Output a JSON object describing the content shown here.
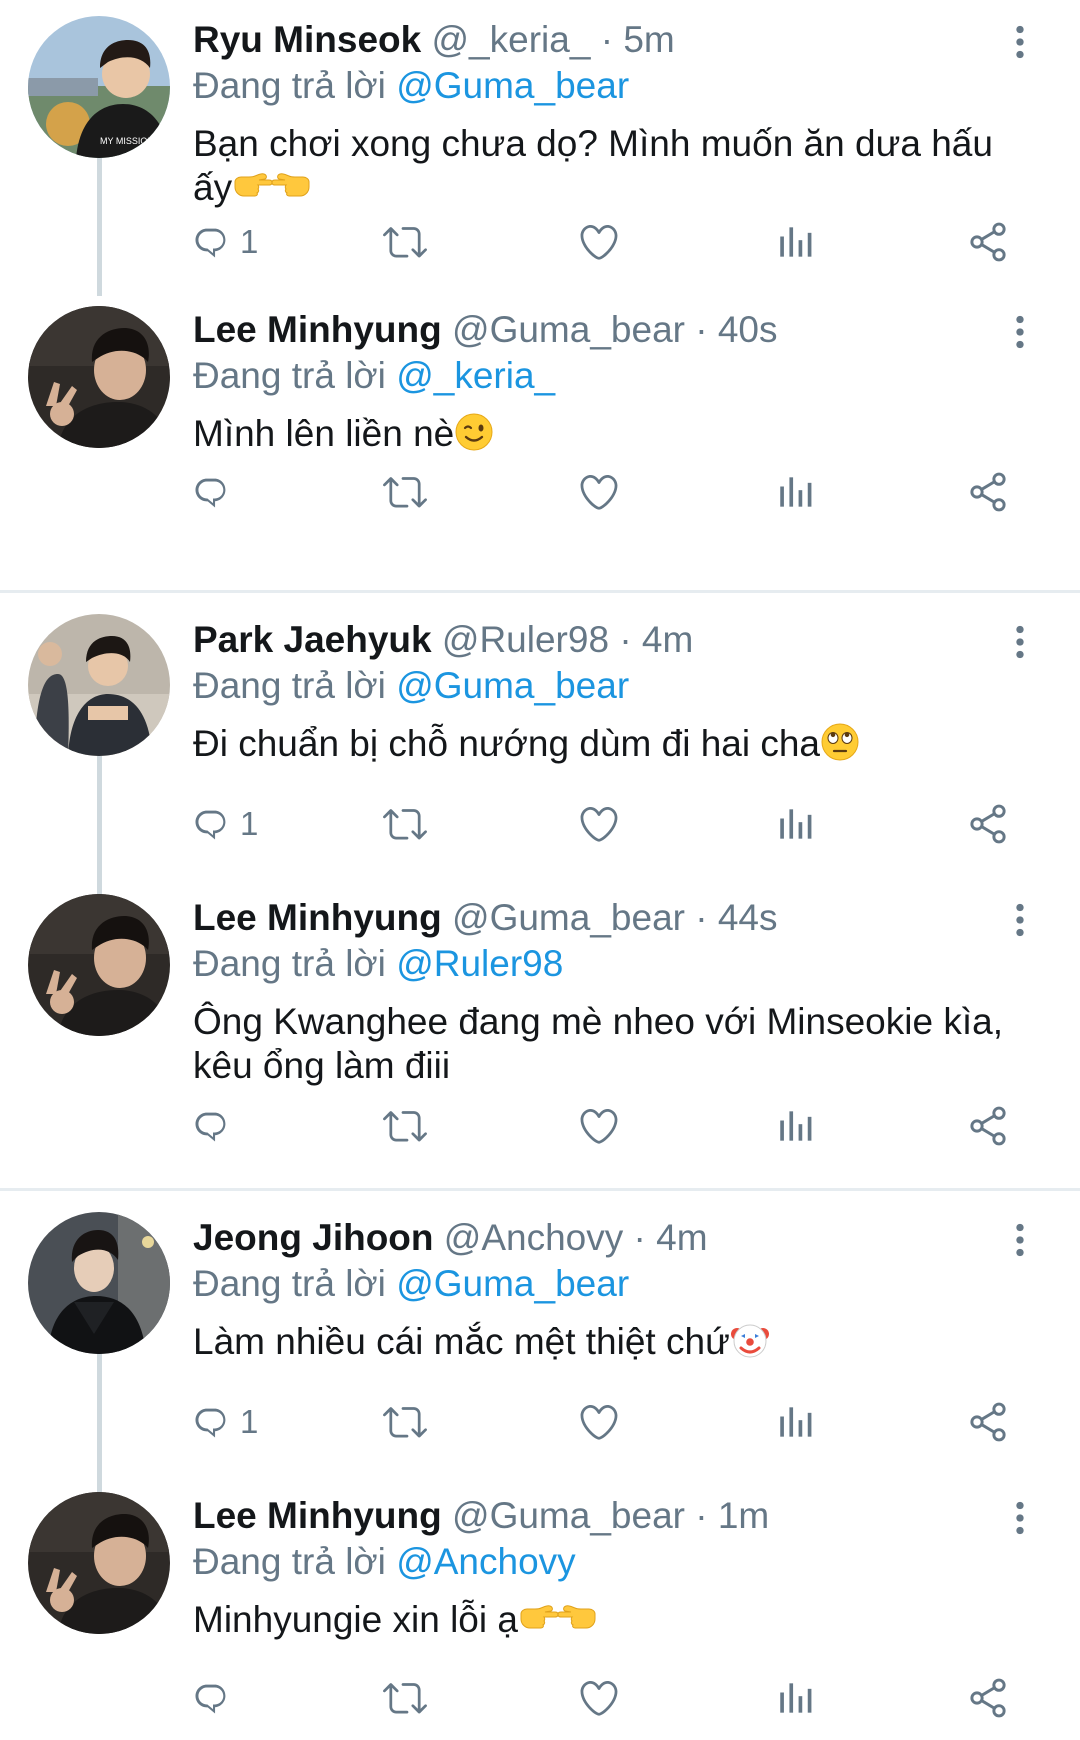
{
  "reply_prefix": "Đang trả lời",
  "threads": [
    {
      "tweets": [
        {
          "name": "Ryu Minseok",
          "handle": "@_keria_",
          "separator": "·",
          "time": "5m",
          "reply_to": "@Guma_bear",
          "text_line1": "Bạn chơi xong chưa dọ? Mình muốn ăn dưa hấu",
          "text_line2": "ấy",
          "emojis": [
            "pointing-right-emoji",
            "pointing-left-emoji"
          ],
          "reply_count": "1",
          "avatar": "ryu-minseok-avatar"
        },
        {
          "name": "Lee Minhyung",
          "handle": "@Guma_bear",
          "separator": "·",
          "time": "40s",
          "reply_to": "@_keria_",
          "text_line1": "Mình lên liền nè",
          "emojis": [
            "winking-face-emoji"
          ],
          "reply_count": "",
          "avatar": "lee-minhyung-avatar"
        }
      ]
    },
    {
      "tweets": [
        {
          "name": "Park Jaehyuk",
          "handle": "@Ruler98",
          "separator": "·",
          "time": "4m",
          "reply_to": "@Guma_bear",
          "text_line1": "Đi chuẩn bị chỗ nướng dùm đi hai cha",
          "emojis": [
            "eye-roll-emoji"
          ],
          "reply_count": "1",
          "avatar": "park-jaehyuk-avatar"
        },
        {
          "name": "Lee Minhyung",
          "handle": "@Guma_bear",
          "separator": "·",
          "time": "44s",
          "reply_to": "@Ruler98",
          "text_line1": "Ông Kwanghee đang mè nheo với Minseokie kìa,",
          "text_line2": "kêu ổng làm điii",
          "reply_count": "",
          "avatar": "lee-minhyung-avatar"
        }
      ]
    },
    {
      "tweets": [
        {
          "name": "Jeong Jihoon",
          "handle": "@Anchovy",
          "separator": "·",
          "time": "4m",
          "reply_to": "@Guma_bear",
          "text_line1": "Làm nhiều cái mắc mệt thiệt chứ",
          "emojis": [
            "clown-face-emoji"
          ],
          "reply_count": "1",
          "avatar": "jeong-jihoon-avatar"
        },
        {
          "name": "Lee Minhyung",
          "handle": "@Guma_bear",
          "separator": "·",
          "time": "1m",
          "reply_to": "@Anchovy",
          "text_line1": "Minhyungie xin lỗi ạ",
          "emojis": [
            "pointing-right-emoji",
            "pointing-left-emoji"
          ],
          "reply_count": "",
          "avatar": "lee-minhyung-avatar"
        }
      ]
    }
  ],
  "colors": {
    "name": "#14171a",
    "secondary": "#657786",
    "mention": "#1b95e0",
    "connector": "#cfd9de",
    "divider": "#e6ecf0"
  }
}
